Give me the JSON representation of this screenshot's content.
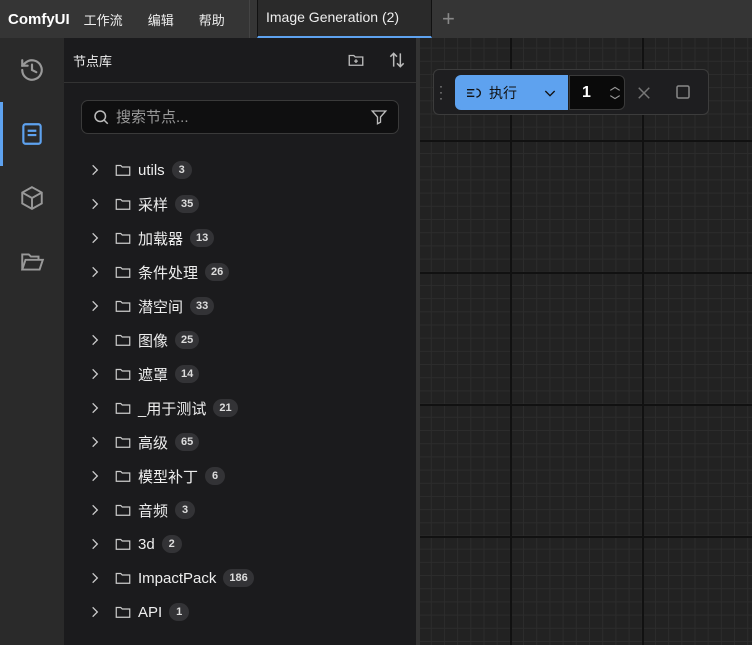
{
  "app": {
    "brand": "ComfyUI",
    "menu": [
      "工作流",
      "编辑",
      "帮助"
    ],
    "tab": "Image Generation (2)"
  },
  "panel": {
    "title": "节点库",
    "search_placeholder": "搜索节点...",
    "items": [
      {
        "label": "utils",
        "count": "3"
      },
      {
        "label": "采样",
        "count": "35"
      },
      {
        "label": "加载器",
        "count": "13"
      },
      {
        "label": "条件处理",
        "count": "26"
      },
      {
        "label": "潜空间",
        "count": "33"
      },
      {
        "label": "图像",
        "count": "25"
      },
      {
        "label": "遮罩",
        "count": "14"
      },
      {
        "label": "_用于测试",
        "count": "21"
      },
      {
        "label": "高级",
        "count": "65"
      },
      {
        "label": "模型补丁",
        "count": "6"
      },
      {
        "label": "音频",
        "count": "3"
      },
      {
        "label": "3d",
        "count": "2"
      },
      {
        "label": "ImpactPack",
        "count": "186"
      },
      {
        "label": "API",
        "count": "1"
      }
    ]
  },
  "run": {
    "label": "执行",
    "count": "1"
  },
  "colors": {
    "accent": "#5ea2ef"
  }
}
